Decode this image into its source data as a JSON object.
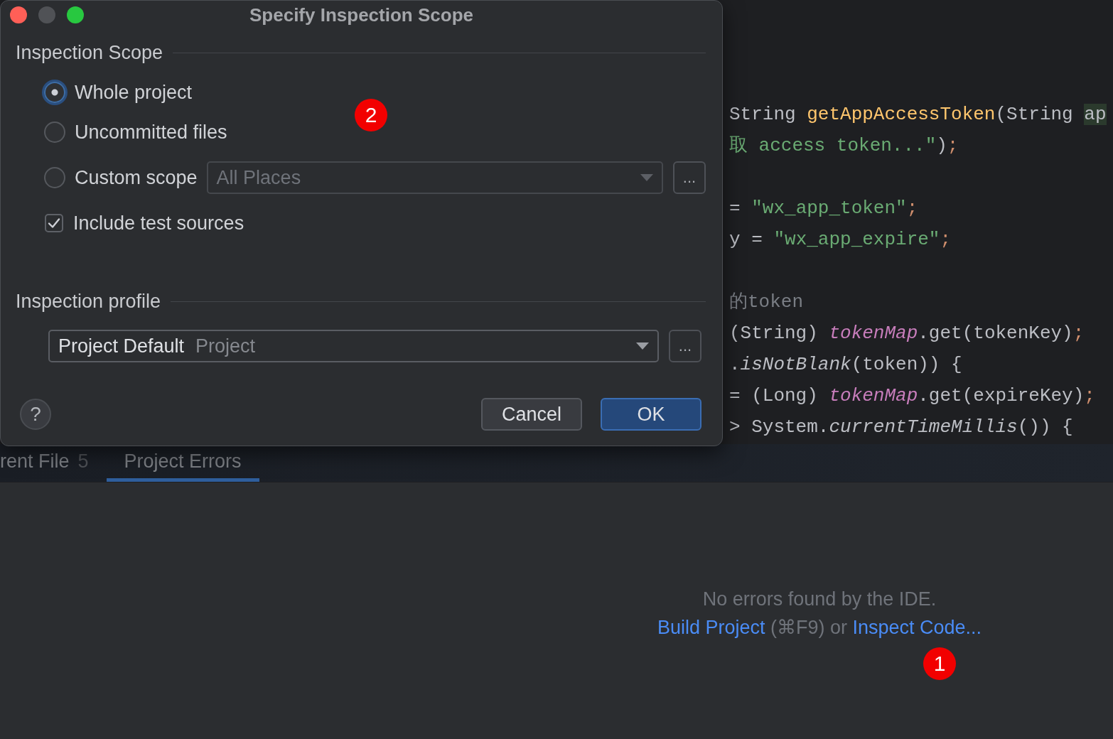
{
  "editor": {
    "blocks": [
      [
        [
          {
            "kind": "plain",
            "text": "String "
          },
          {
            "kind": "method",
            "text": "getAppAccessToken"
          },
          {
            "kind": "plain",
            "text": "(String "
          },
          {
            "kind": "usage",
            "text": "ap"
          }
        ],
        [
          {
            "kind": "string",
            "text": "取 access token...\""
          },
          {
            "kind": "plain",
            "text": ")"
          },
          {
            "kind": "punct",
            "text": ";"
          }
        ]
      ],
      [
        [
          {
            "kind": "plain",
            "text": "= "
          },
          {
            "kind": "string",
            "text": "\"wx_app_token\""
          },
          {
            "kind": "punct",
            "text": ";"
          }
        ],
        [
          {
            "kind": "plain",
            "text": "y = "
          },
          {
            "kind": "string",
            "text": "\"wx_app_expire\""
          },
          {
            "kind": "punct",
            "text": ";"
          }
        ]
      ],
      [
        [
          {
            "kind": "comment",
            "text": "的token"
          }
        ],
        [
          {
            "kind": "plain",
            "text": "(String) "
          },
          {
            "kind": "field",
            "text": "tokenMap"
          },
          {
            "kind": "plain",
            "text": ".get(tokenKey)"
          },
          {
            "kind": "punct",
            "text": ";"
          }
        ],
        [
          {
            "kind": "plain",
            "text": "."
          },
          {
            "kind": "static",
            "text": "isNotBlank"
          },
          {
            "kind": "plain",
            "text": "(token)) {"
          }
        ],
        [
          {
            "kind": "plain",
            "text": "= (Long) "
          },
          {
            "kind": "field",
            "text": "tokenMap"
          },
          {
            "kind": "plain",
            "text": ".get(expireKey)"
          },
          {
            "kind": "punct",
            "text": ";"
          }
        ],
        [
          {
            "kind": "plain",
            "text": "> System."
          },
          {
            "kind": "static",
            "text": "currentTimeMillis"
          },
          {
            "kind": "plain",
            "text": "()) {"
          }
        ]
      ]
    ]
  },
  "dialog": {
    "title": "Specify Inspection Scope",
    "window_controls": [
      {
        "kind": "close",
        "disabled": false
      },
      {
        "kind": "minimize",
        "disabled": true
      },
      {
        "kind": "zoom",
        "disabled": false
      }
    ],
    "marker": "2",
    "scope": {
      "label": "Inspection Scope",
      "options": [
        {
          "label": "Whole project",
          "selected": true,
          "focused": true
        },
        {
          "label": "Uncommitted files",
          "selected": false,
          "focused": false
        },
        {
          "label": "Custom scope",
          "selected": false,
          "focused": false,
          "dropdown": {
            "value": "All Places",
            "disabled": true
          },
          "browse_button": "..."
        }
      ],
      "include_tests": {
        "label": "Include test sources",
        "checked": true
      }
    },
    "profile": {
      "label": "Inspection profile",
      "dropdown": {
        "value": "Project Default",
        "detail": "Project"
      },
      "browse_button": "..."
    },
    "help_button": "?",
    "buttons": [
      {
        "label": "Cancel",
        "default": false
      },
      {
        "label": "OK",
        "default": true
      }
    ]
  },
  "bottom_panel": {
    "tabs": [
      {
        "label": "rent File",
        "count": "5",
        "selected": false
      },
      {
        "label": "Project Errors",
        "selected": true
      }
    ],
    "empty_state": {
      "message": "No errors found by the IDE.",
      "hint": [
        {
          "kind": "link",
          "text": "Build Project"
        },
        {
          "kind": "text",
          "text": "(⌘F9) or"
        },
        {
          "kind": "link",
          "text": "Inspect Code..."
        }
      ],
      "marker": "1"
    }
  }
}
